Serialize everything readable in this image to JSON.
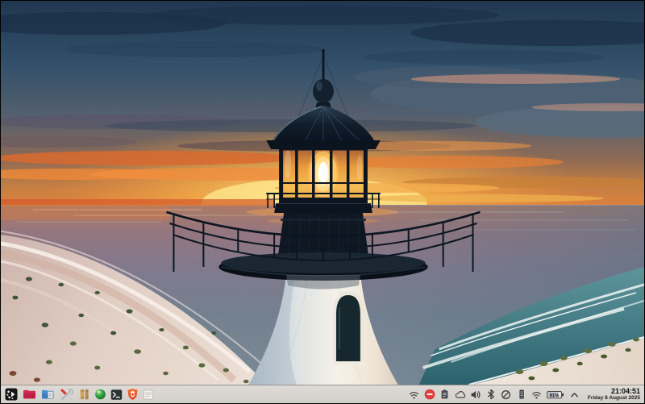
{
  "desktop": {
    "wallpaper_description": "Lighthouse lantern glowing at sunset over the sea, white tower with arched window, beach with waves and shrubs below"
  },
  "taskbar": {
    "launchers": [
      {
        "name": "app-menu",
        "icon": "dot-swirl on dark square"
      },
      {
        "name": "red-folder",
        "icon": "red folder"
      },
      {
        "name": "file-manager",
        "icon": "blue folder with document"
      },
      {
        "name": "system-tools",
        "icon": "crossed wrench and screwdriver"
      },
      {
        "name": "books",
        "icon": "tan books"
      },
      {
        "name": "green-globe",
        "icon": "green sphere"
      },
      {
        "name": "terminal",
        "icon": "dark terminal prompt"
      },
      {
        "name": "brave-browser",
        "icon": "orange shield"
      },
      {
        "name": "notes",
        "icon": "light notepad"
      }
    ],
    "tray": [
      {
        "name": "wifi"
      },
      {
        "name": "do-not-disturb"
      },
      {
        "name": "clipboard"
      },
      {
        "name": "cloud"
      },
      {
        "name": "volume"
      },
      {
        "name": "bluetooth"
      },
      {
        "name": "night-light"
      },
      {
        "name": "mobile-device"
      },
      {
        "name": "network"
      },
      {
        "name": "battery"
      },
      {
        "name": "expand-tray"
      }
    ],
    "battery_percent": "81%",
    "clock_time": "21:04:51",
    "clock_date": "Friday 8 August 2025"
  },
  "colors": {
    "taskbar_bg": "#d8d5d0",
    "dnd_red": "#e04040",
    "brave_orange": "#fb542b",
    "sky_top": "#20374e",
    "sunset_glow": "#ffd96a",
    "sea_teal": "#3f7782",
    "sand": "#e6d8ce"
  }
}
